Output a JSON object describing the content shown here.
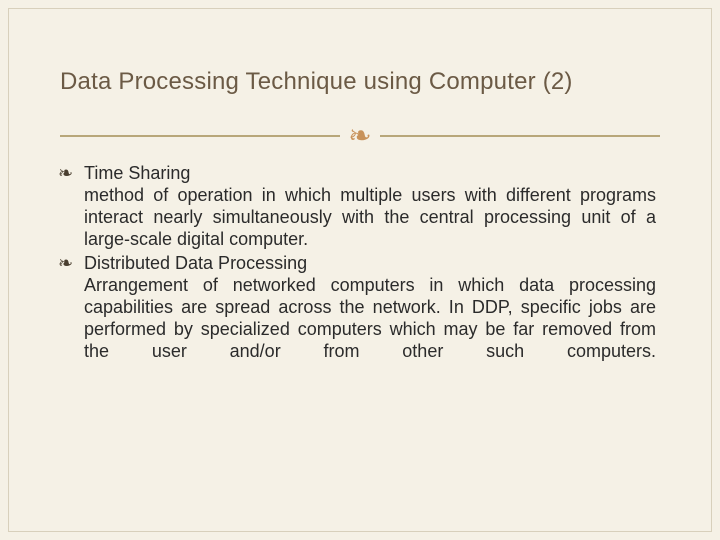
{
  "slide": {
    "title": "Data Processing Technique using Computer (2)",
    "flourish": "❧",
    "bullets": [
      {
        "marker": "❧",
        "head": "Time Sharing",
        "body": "method of operation in which multiple users with different programs interact nearly simultaneously with the central processing unit of a large-scale digital computer."
      },
      {
        "marker": "❧",
        "head": "Distributed Data Processing",
        "body": "Arrangement of networked computers in which data processing capabilities are spread across the network. In DDP, specific jobs are performed by specialized computers which may be far removed from the user and/or from other such computers."
      }
    ]
  }
}
